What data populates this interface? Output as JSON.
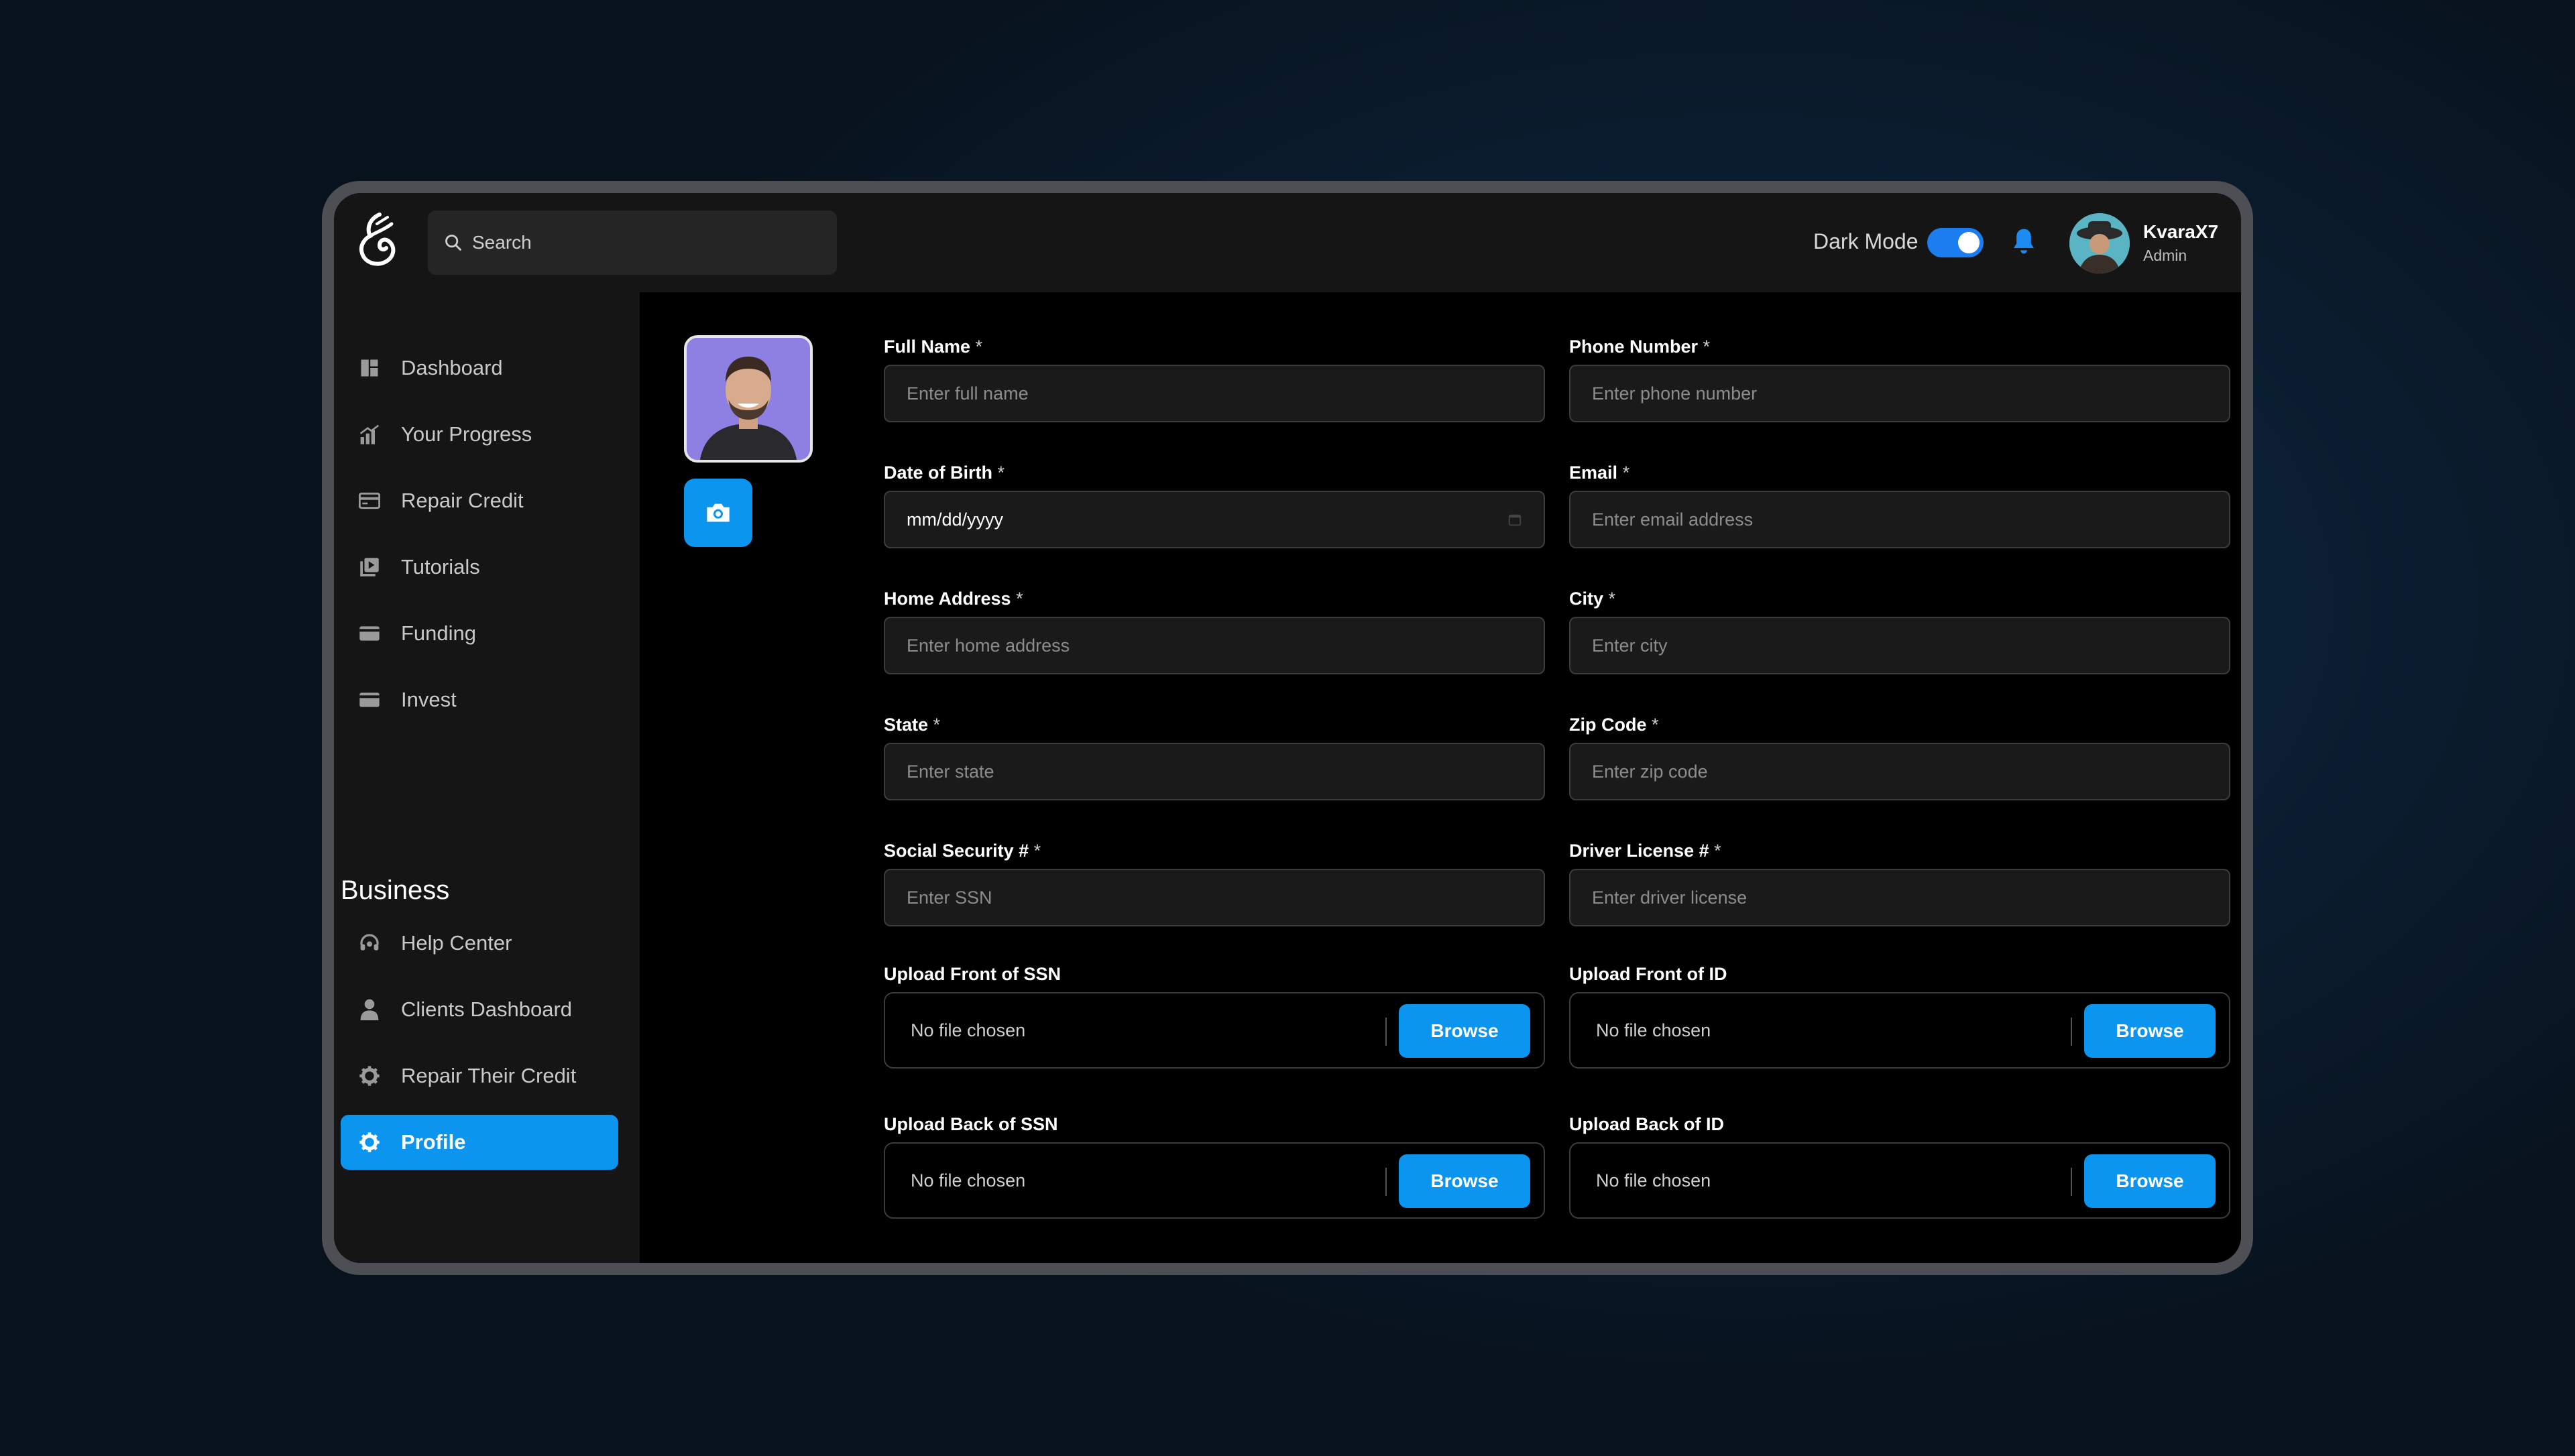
{
  "header": {
    "search_placeholder": "Search",
    "dark_mode_label": "Dark Mode",
    "dark_mode_on": true,
    "user": {
      "name": "KvaraX7",
      "role": "Admin"
    }
  },
  "sidebar": {
    "items": [
      {
        "label": "Dashboard",
        "icon": "dashboard-icon"
      },
      {
        "label": "Your Progress",
        "icon": "chart-icon"
      },
      {
        "label": "Repair Credit",
        "icon": "card-icon"
      },
      {
        "label": "Tutorials",
        "icon": "video-library-icon"
      },
      {
        "label": "Funding",
        "icon": "card-icon"
      },
      {
        "label": "Invest",
        "icon": "card-icon"
      }
    ],
    "section_title": "Business",
    "business_items": [
      {
        "label": "Help Center",
        "icon": "headset-icon"
      },
      {
        "label": "Clients Dashboard",
        "icon": "user-icon"
      },
      {
        "label": "Repair Their Credit",
        "icon": "gear-icon"
      },
      {
        "label": "Profile",
        "icon": "gear-icon",
        "active": true
      }
    ]
  },
  "form": {
    "required_mark": "*",
    "full_name": {
      "label": "Full Name",
      "placeholder": "Enter full name"
    },
    "phone": {
      "label": "Phone Number",
      "placeholder": "Enter phone number"
    },
    "dob": {
      "label": "Date of Birth",
      "value": "mm/dd/yyyy"
    },
    "email": {
      "label": "Email",
      "placeholder": "Enter email address"
    },
    "home_address": {
      "label": "Home Address",
      "placeholder": "Enter home address"
    },
    "city": {
      "label": "City",
      "placeholder": "Enter city"
    },
    "state": {
      "label": "State",
      "placeholder": "Enter state"
    },
    "zip": {
      "label": "Zip Code",
      "placeholder": "Enter zip code"
    },
    "ssn": {
      "label": "Social Security #",
      "placeholder": "Enter SSN"
    },
    "license": {
      "label": "Driver License #",
      "placeholder": "Enter driver license"
    },
    "uploads": {
      "front_ssn": "Upload Front of SSN",
      "front_id": "Upload Front of ID",
      "back_ssn": "Upload Back of SSN",
      "back_id": "Upload Back of ID",
      "no_file": "No file chosen",
      "browse": "Browse"
    }
  }
}
